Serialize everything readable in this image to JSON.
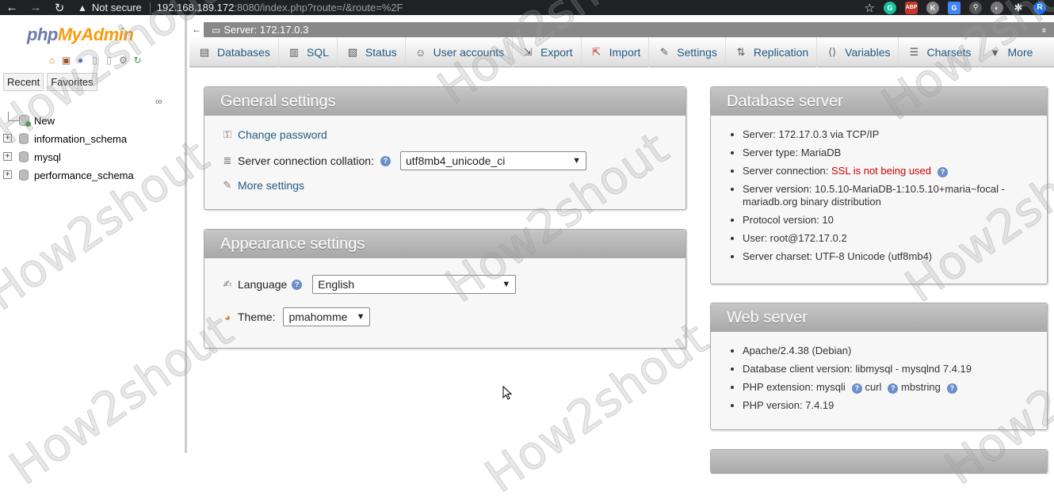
{
  "browser": {
    "security": "Not secure",
    "url_host": "192.168.189.172",
    "url_rest": ":8080/index.php?route=/&route=%2F",
    "profile": "R"
  },
  "sidebar": {
    "logo_php": "php",
    "logo_my": "MyAdmin",
    "tabs": [
      "Recent",
      "Favorites"
    ],
    "tree": {
      "new_label": "New",
      "databases": [
        "information_schema",
        "mysql",
        "performance_schema"
      ]
    }
  },
  "server_bar": {
    "label": "Server: 172.17.0.3"
  },
  "menu": [
    "Databases",
    "SQL",
    "Status",
    "User accounts",
    "Export",
    "Import",
    "Settings",
    "Replication",
    "Variables",
    "Charsets",
    "More"
  ],
  "general": {
    "title": "General settings",
    "change_password": "Change password",
    "collation_label": "Server connection collation:",
    "collation_value": "utf8mb4_unicode_ci",
    "more_settings": "More settings"
  },
  "appearance": {
    "title": "Appearance settings",
    "language_label": "Language",
    "language_value": "English",
    "theme_label": "Theme:",
    "theme_value": "pmahomme"
  },
  "db_server": {
    "title": "Database server",
    "server": "Server: 172.17.0.3 via TCP/IP",
    "type": "Server type: MariaDB",
    "conn_label": "Server connection: ",
    "conn_value": "SSL is not being used",
    "version": "Server version: 10.5.10-MariaDB-1:10.5.10+maria~focal - mariadb.org binary distribution",
    "protocol": "Protocol version: 10",
    "user": "User: root@172.17.0.2",
    "charset": "Server charset: UTF-8 Unicode (utf8mb4)"
  },
  "web_server": {
    "title": "Web server",
    "apache": "Apache/2.4.38 (Debian)",
    "client": "Database client version: libmysql - mysqlnd 7.4.19",
    "ext_label": "PHP extension: mysqli",
    "ext_curl": "curl",
    "ext_mbstring": "mbstring",
    "php_version": "PHP version: 7.4.19"
  },
  "watermark": "How2shout"
}
